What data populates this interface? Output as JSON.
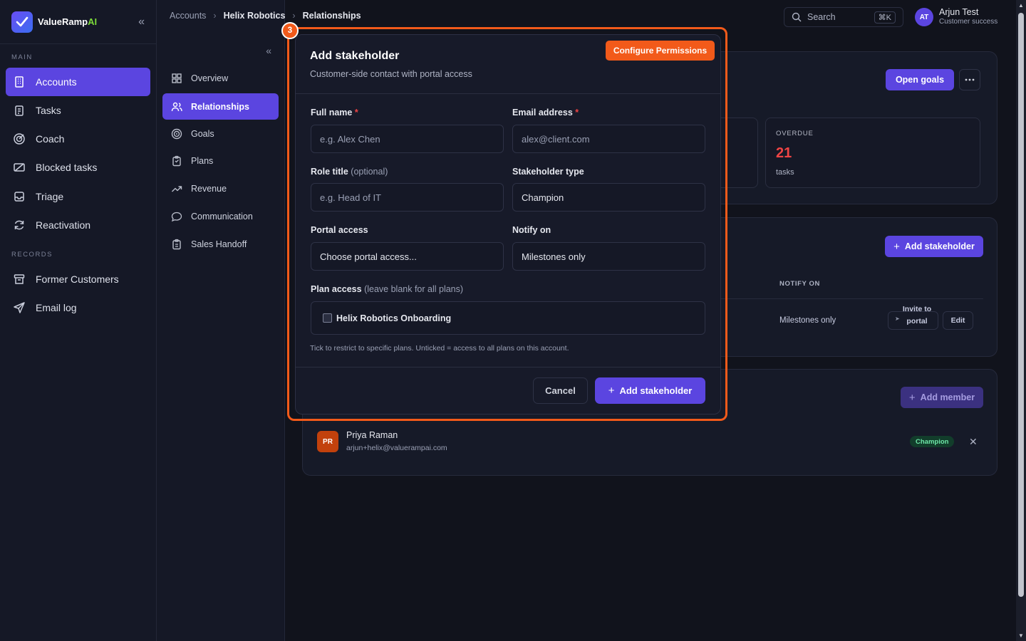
{
  "brand": {
    "name_main": "ValueRamp",
    "name_ai": "AI"
  },
  "sidebar": {
    "main_label": "MAIN",
    "records_label": "RECORDS",
    "main_items": [
      {
        "label": "Accounts",
        "icon": "building-icon"
      },
      {
        "label": "Tasks",
        "icon": "clipboard-icon"
      },
      {
        "label": "Coach",
        "icon": "target-icon"
      },
      {
        "label": "Blocked tasks",
        "icon": "blocked-icon"
      },
      {
        "label": "Triage",
        "icon": "inbox-icon"
      },
      {
        "label": "Reactivation",
        "icon": "refresh-icon"
      }
    ],
    "record_items": [
      {
        "label": "Former Customers",
        "icon": "archive-icon"
      },
      {
        "label": "Email log",
        "icon": "send-icon"
      }
    ]
  },
  "subnav": {
    "items": [
      {
        "label": "Overview",
        "icon": "grid-icon"
      },
      {
        "label": "Relationships",
        "icon": "users-icon"
      },
      {
        "label": "Goals",
        "icon": "goal-icon"
      },
      {
        "label": "Plans",
        "icon": "clipboard-icon"
      },
      {
        "label": "Revenue",
        "icon": "trend-icon"
      },
      {
        "label": "Communication",
        "icon": "chat-icon"
      },
      {
        "label": "Sales Handoff",
        "icon": "clipboard-list-icon"
      }
    ]
  },
  "breadcrumb": {
    "root": "Accounts",
    "account": "Helix Robotics",
    "current": "Relationships"
  },
  "search": {
    "label": "Search",
    "shortcut": "⌘K"
  },
  "user": {
    "initials": "AT",
    "name": "Arjun Test",
    "role": "Customer success"
  },
  "background": {
    "open_goals": "Open goals",
    "overdue_label": "OVERDUE",
    "overdue_value": "21",
    "overdue_unit": "tasks",
    "add_stakeholder": "Add stakeholder",
    "notify_on_header": "NOTIFY ON",
    "row_notify": "Milestones only",
    "invite_label": "Invite to portal",
    "edit_label": "Edit",
    "add_member": "Add member",
    "member": {
      "initials": "PR",
      "name": "Priya Raman",
      "email": "arjun+helix@valuerampai.com",
      "badge": "Champion"
    }
  },
  "modal": {
    "step": "3",
    "title": "Add stakeholder",
    "subtitle": "Customer-side contact with portal access",
    "configure_permissions": "Configure Permissions",
    "full_name_label": "Full name",
    "full_name_placeholder": "e.g. Alex Chen",
    "email_label": "Email address",
    "email_placeholder": "alex@client.com",
    "role_label": "Role title",
    "role_optional": "(optional)",
    "role_placeholder": "e.g. Head of IT",
    "type_label": "Stakeholder type",
    "type_value": "Champion",
    "portal_label": "Portal access",
    "portal_value": "Choose portal access...",
    "notify_label": "Notify on",
    "notify_value": "Milestones only",
    "plan_label": "Plan access",
    "plan_hint_inline": "(leave blank for all plans)",
    "plan_option": "Helix Robotics Onboarding",
    "hint": "Tick to restrict to specific plans. Unticked = access to all plans on this account.",
    "cancel": "Cancel",
    "submit": "Add stakeholder",
    "required_mark": "*"
  },
  "colors": {
    "accent": "#5b45e0",
    "highlight": "#f25a1a",
    "danger": "#ef4444",
    "background": "#11131c"
  }
}
